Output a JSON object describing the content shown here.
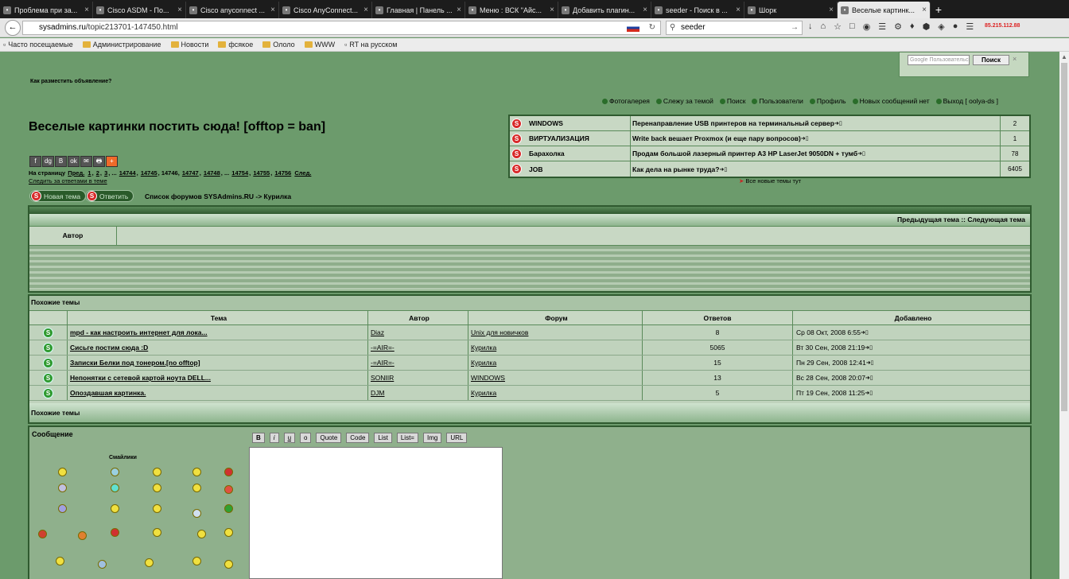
{
  "tabs": [
    {
      "icon": "warning-icon",
      "title": "Проблема при за...",
      "active": false
    },
    {
      "icon": "cisco-icon",
      "title": "Cisco ASDM - По...",
      "active": false
    },
    {
      "icon": "google-icon",
      "title": "Cisco anyconnect ...",
      "active": false
    },
    {
      "icon": "bookmark-icon",
      "title": "Cisco AnyConnect...",
      "active": false
    },
    {
      "icon": "panel-icon",
      "title": "Главная | Панель ...",
      "active": false
    },
    {
      "icon": "menu-icon",
      "title": "Меню : ВСК \"Айс...",
      "active": false
    },
    {
      "icon": "plugin-icon",
      "title": "Добавить плагин...",
      "active": false
    },
    {
      "icon": "google-icon",
      "title": "seeder - Поиск в ...",
      "active": false
    },
    {
      "icon": "shork-icon",
      "title": "Шорк",
      "active": false
    },
    {
      "icon": "sysadmins-icon",
      "title": "Веселые картинк...",
      "active": true
    }
  ],
  "nav": {
    "url_domain": "sysadmins.ru",
    "url_path": "/topic213701-147450.html",
    "search_value": "seeder",
    "ip": "85.215.112.88"
  },
  "bookmarks": [
    {
      "label": "Часто посещаемые",
      "type": "page"
    },
    {
      "label": "Администрирование",
      "type": "folder"
    },
    {
      "label": "Новости",
      "type": "folder"
    },
    {
      "label": "фсякое",
      "type": "folder"
    },
    {
      "label": "Ололо",
      "type": "folder"
    },
    {
      "label": "WWW",
      "type": "folder"
    },
    {
      "label": "RT на русском",
      "type": "page"
    }
  ],
  "google": {
    "placeholder": "Google  Пользовательский поиск",
    "button": "Поиск",
    "close": "×"
  },
  "ad_link": "Как разместить объявление?",
  "topnav": [
    "Фотогалерея",
    "Слежу за темой",
    "Поиск",
    "Пользователи",
    "Профиль",
    "Новых сообщений нет",
    "Выход [ oolya-ds ]"
  ],
  "topic": {
    "title": "Веселые картинки постить сюда! [offtop = ban]",
    "pager_prefix": "На страницу",
    "pager_prev": "Пред.",
    "pager_pages": [
      "1",
      "2",
      "3",
      "...",
      "14744",
      "14745",
      "14746",
      "14747",
      "14748",
      "...",
      "14754",
      "14755",
      "14756"
    ],
    "pager_next": "След.",
    "follow": "Следить за ответами в теме",
    "btn_new": "Новая тема",
    "btn_reply": "Ответить",
    "breadcrumb": "Список форумов SYSAdmins.RU -> Курилка"
  },
  "share_icons": [
    "f",
    "dg",
    "B",
    "ok",
    "✉",
    "🖶",
    "+"
  ],
  "right_topics": [
    {
      "forum": "WINDOWS",
      "topic": "Перенаправление USB принтеров на терминальный сервер",
      "count": "2"
    },
    {
      "forum": "ВИРТУАЛИЗАЦИЯ",
      "topic": "Write back вешает Proxmox (и еще пару вопросов)",
      "count": "1"
    },
    {
      "forum": "Барахолка",
      "topic": "Продам большой лазерный принтер A3 HP LaserJet 9050DN + тумб",
      "count": "78"
    },
    {
      "forum": "JOB",
      "topic": "Как дела на рынке труда?",
      "count": "6405"
    }
  ],
  "all_new": "Все новые темы тут",
  "post": {
    "nav": "Предыдущая тема :: Следующая тема",
    "author_label": "Автор"
  },
  "similar": {
    "title": "Похожие темы",
    "footer": "Похожие темы",
    "columns": [
      "Тема",
      "Автор",
      "Форум",
      "Ответов",
      "Добавлено"
    ],
    "rows": [
      {
        "topic": "mpd - как настроить интернет для лока...",
        "author": "Diaz",
        "forum": "Unix для новичков",
        "replies": "8",
        "added": "Ср 08 Окт, 2008 6:55"
      },
      {
        "topic": "Сисьге постим сюда :D",
        "author": "-=AIR=-",
        "forum": "Курилка",
        "replies": "5065",
        "added": "Вт 30 Сен, 2008 21:19"
      },
      {
        "topic": "Записки Белки под тонером.[no offtop]",
        "author": "-=AIR=-",
        "forum": "Курилка",
        "replies": "15",
        "added": "Пн 29 Сен, 2008 12:41"
      },
      {
        "topic": "Непонятки с сетевой картой ноута DELL...",
        "author": "SONIIR",
        "forum": "WINDOWS",
        "replies": "13",
        "added": "Вс 28 Сен, 2008 20:07"
      },
      {
        "topic": "Опоздавшая картинка.",
        "author": "DJM",
        "forum": "Курилка",
        "replies": "5",
        "added": "Пт 19 Сен, 2008 11:25"
      }
    ]
  },
  "message": {
    "label": "Сообщение",
    "smileys_label": "Смайлики",
    "buttons": [
      "B",
      "i",
      "u",
      "o",
      "Quote",
      "Code",
      "List",
      "List=",
      "Img",
      "URL"
    ]
  },
  "colors": {
    "page_bg": "#6c9b6c",
    "accent_red": "#d82a2a",
    "accent_green": "#2f9a2f"
  }
}
